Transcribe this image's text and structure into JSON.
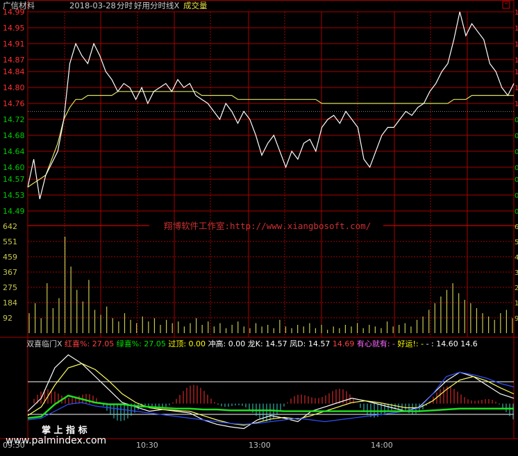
{
  "header": {
    "stock_name": "广信材料",
    "date": "2018-03-28",
    "mode": "分时",
    "indicator_name": "好用分时线X",
    "volume_label": "成交量"
  },
  "watermark": "翔博软件工作室:http://www.xiangbosoft.com/",
  "logo": "掌 上 指 标",
  "site": "www.palmindex.com",
  "indicator_bar": [
    {
      "text": "双喜临门X",
      "color": "#c8c8c8"
    },
    {
      "text": "红喜%: 27.05",
      "color": "#ff4040"
    },
    {
      "text": "绿喜%: 27.05",
      "color": "#00e000"
    },
    {
      "text": "过顶: 0.00",
      "color": "#ffff00"
    },
    {
      "text": "冲高: 0.00",
      "color": "#ffffff"
    },
    {
      "text": "龙K: 14.57",
      "color": "#ffffff"
    },
    {
      "text": "凤D: 14.57",
      "color": "#ffffff"
    },
    {
      "text": "14.69",
      "color": "#ff4040"
    },
    {
      "text": "有心就有: -",
      "color": "#ff66ff"
    },
    {
      "text": "好运!: -",
      "color": "#ffff00"
    },
    {
      "text": "- : 14.60",
      "color": "#ffffff"
    },
    {
      "text": "14.6",
      "color": "#ffffff"
    }
  ],
  "colors": {
    "background": "#000000",
    "grid": "#aa0000",
    "price_line": "#ffffff",
    "avg_line": "#e0e060",
    "volume_bar": "#c8c850",
    "up_label": "#ff3030",
    "down_label": "#00cc00",
    "volume_label": "#c8c850",
    "time_label": "#c0c0c0"
  },
  "chart_data": [
    {
      "type": "line",
      "x_ticks": [
        "09:30",
        "10:30",
        "13:00",
        "14:00"
      ],
      "y_ticks": [
        14.99,
        14.95,
        14.91,
        14.87,
        14.84,
        14.8,
        14.76,
        14.72,
        14.68,
        14.64,
        14.6,
        14.57,
        14.53,
        14.49
      ],
      "reference_price": 14.74,
      "ylim": [
        14.49,
        14.99
      ],
      "series": [
        {
          "role": "price",
          "values": [
            14.55,
            14.62,
            14.52,
            14.58,
            14.61,
            14.64,
            14.72,
            14.86,
            14.91,
            14.88,
            14.86,
            14.91,
            14.88,
            14.84,
            14.82,
            14.79,
            14.81,
            14.8,
            14.77,
            14.8,
            14.76,
            14.79,
            14.8,
            14.81,
            14.79,
            14.82,
            14.8,
            14.81,
            14.78,
            14.77,
            14.76,
            14.74,
            14.72,
            14.76,
            14.74,
            14.71,
            14.74,
            14.72,
            14.68,
            14.63,
            14.66,
            14.68,
            14.64,
            14.6,
            14.64,
            14.62,
            14.66,
            14.67,
            14.64,
            14.7,
            14.72,
            14.73,
            14.71,
            14.74,
            14.72,
            14.7,
            14.62,
            14.6,
            14.64,
            14.68,
            14.7,
            14.7,
            14.72,
            14.74,
            14.73,
            14.75,
            14.76,
            14.79,
            14.81,
            14.84,
            14.86,
            14.92,
            14.99,
            14.93,
            14.96,
            14.94,
            14.92,
            14.86,
            14.84,
            14.8,
            14.78,
            14.81
          ]
        },
        {
          "role": "average",
          "values": [
            14.55,
            14.56,
            14.57,
            14.58,
            14.62,
            14.66,
            14.72,
            14.75,
            14.77,
            14.77,
            14.78,
            14.78,
            14.78,
            14.78,
            14.78,
            14.79,
            14.79,
            14.79,
            14.79,
            14.79,
            14.79,
            14.79,
            14.79,
            14.79,
            14.79,
            14.79,
            14.79,
            14.79,
            14.79,
            14.78,
            14.78,
            14.78,
            14.78,
            14.78,
            14.78,
            14.77,
            14.77,
            14.77,
            14.77,
            14.77,
            14.77,
            14.77,
            14.77,
            14.77,
            14.77,
            14.77,
            14.77,
            14.77,
            14.77,
            14.76,
            14.76,
            14.76,
            14.76,
            14.76,
            14.76,
            14.76,
            14.76,
            14.76,
            14.76,
            14.76,
            14.76,
            14.76,
            14.76,
            14.76,
            14.76,
            14.76,
            14.76,
            14.76,
            14.76,
            14.76,
            14.76,
            14.77,
            14.77,
            14.77,
            14.78,
            14.78,
            14.78,
            14.78,
            14.78,
            14.78,
            14.78,
            14.78
          ]
        }
      ]
    },
    {
      "type": "bar",
      "y_ticks": [
        642,
        551,
        459,
        367,
        275,
        184,
        92
      ],
      "ylim": [
        0,
        642
      ],
      "values": [
        120,
        180,
        90,
        300,
        150,
        210,
        580,
        400,
        260,
        190,
        320,
        140,
        110,
        160,
        90,
        70,
        120,
        80,
        60,
        100,
        70,
        90,
        50,
        80,
        60,
        70,
        40,
        60,
        90,
        50,
        70,
        40,
        60,
        30,
        50,
        70,
        40,
        30,
        60,
        40,
        50,
        30,
        80,
        40,
        30,
        50,
        40,
        60,
        30,
        50,
        20,
        40,
        30,
        50,
        40,
        60,
        30,
        50,
        40,
        30,
        70,
        40,
        50,
        60,
        40,
        80,
        100,
        140,
        180,
        220,
        260,
        300,
        240,
        200,
        180,
        150,
        120,
        100,
        80,
        120,
        140,
        90
      ]
    },
    {
      "type": "line",
      "role": "indicator",
      "series": [
        {
          "role": "white-k",
          "values": [
            0.3,
            0.45,
            0.8,
            0.95,
            0.85,
            0.7,
            0.55,
            0.4,
            0.35,
            0.3,
            0.32,
            0.3,
            0.28,
            0.2,
            0.15,
            0.12,
            0.1,
            0.2,
            0.25,
            0.22,
            0.18,
            0.3,
            0.35,
            0.4,
            0.45,
            0.42,
            0.38,
            0.34,
            0.3,
            0.35,
            0.5,
            0.65,
            0.75,
            0.7,
            0.6,
            0.5,
            0.45
          ]
        },
        {
          "role": "yellow-d",
          "values": [
            0.25,
            0.35,
            0.6,
            0.8,
            0.85,
            0.78,
            0.65,
            0.5,
            0.4,
            0.34,
            0.32,
            0.31,
            0.3,
            0.25,
            0.2,
            0.16,
            0.14,
            0.17,
            0.21,
            0.23,
            0.21,
            0.25,
            0.3,
            0.35,
            0.4,
            0.42,
            0.4,
            0.37,
            0.34,
            0.34,
            0.42,
            0.55,
            0.66,
            0.7,
            0.65,
            0.57,
            0.5
          ]
        },
        {
          "role": "blue-line",
          "values": [
            0.2,
            0.22,
            0.3,
            0.38,
            0.4,
            0.36,
            0.34,
            0.32,
            0.3,
            0.28,
            0.26,
            0.24,
            0.22,
            0.2,
            0.18,
            0.16,
            0.15,
            0.16,
            0.18,
            0.2,
            0.22,
            0.2,
            0.18,
            0.2,
            0.22,
            0.24,
            0.26,
            0.28,
            0.3,
            0.34,
            0.5,
            0.7,
            0.75,
            0.72,
            0.68,
            0.62,
            0.58
          ]
        },
        {
          "role": "green-line",
          "values": [
            0.22,
            0.24,
            0.38,
            0.48,
            0.44,
            0.4,
            0.38,
            0.38,
            0.36,
            0.35,
            0.34,
            0.33,
            0.33,
            0.32,
            0.32,
            0.31,
            0.31,
            0.31,
            0.31,
            0.3,
            0.3,
            0.3,
            0.3,
            0.3,
            0.3,
            0.3,
            0.3,
            0.3,
            0.3,
            0.3,
            0.31,
            0.32,
            0.33,
            0.33,
            0.33,
            0.33,
            0.33
          ]
        }
      ]
    }
  ]
}
